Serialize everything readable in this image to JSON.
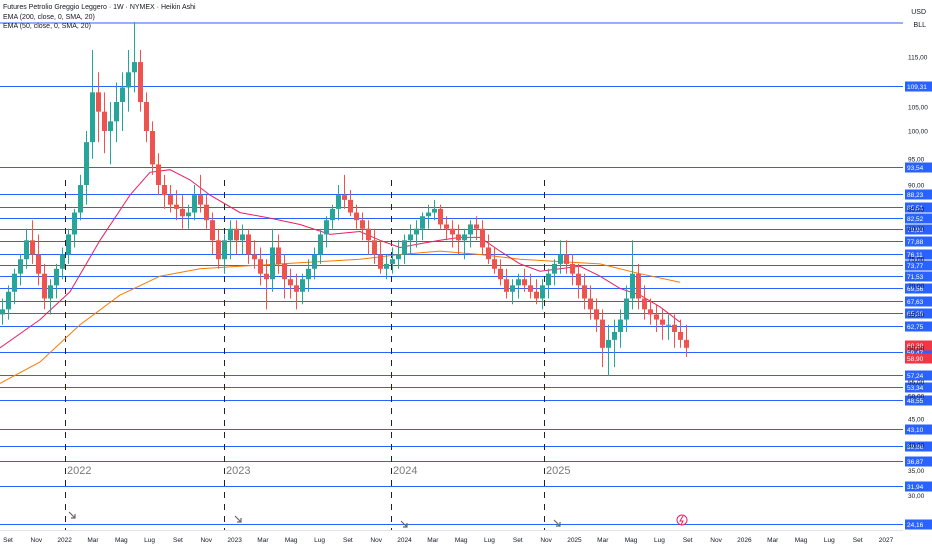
{
  "legend": {
    "title": "Futures Petrolio Greggio Leggero · 1W · NYMEX · Heikin Ashi",
    "ema200": "EMA (200, close, 0, SMA, 20)",
    "ema50": "EMA (50, close, 0, SMA, 20)"
  },
  "scale": {
    "currency": "USD",
    "unit": "BLL"
  },
  "colors": {
    "up": "#26a69a",
    "down": "#ef5350",
    "line": "#2962ff",
    "ema200": "#f57c00",
    "ema50": "#e91e63",
    "price_badge": "#f23645"
  },
  "chart_data": {
    "type": "candlestick",
    "y_axis_ticks": [
      "115,00",
      "105,00",
      "100,00",
      "95,00",
      "90,00",
      "85,00",
      "80,00",
      "75,00",
      "70,00",
      "65,00",
      "60,00",
      "55,00",
      "50,00",
      "45,00",
      "40,00",
      "35,00",
      "30,00"
    ],
    "horizontal_levels": [
      "109,31",
      "93,54",
      "88,23",
      "85,51",
      "82,52",
      "79,93",
      "77,88",
      "76,11",
      "73,77",
      "71,53",
      "69,56",
      "67,63",
      "65,28",
      "62,75",
      "59,47",
      "57,24",
      "53,34",
      "48,55",
      "43,10",
      "39,86",
      "36,87",
      "31,94",
      "24,16"
    ],
    "price_badges": [
      {
        "label": "60,30"
      },
      {
        "label": "58,90"
      }
    ],
    "x_axis_labels": [
      "Set",
      "Nov",
      "2022",
      "Mar",
      "Mag",
      "Lug",
      "Set",
      "Nov",
      "2023",
      "Mar",
      "Mag",
      "Lug",
      "Set",
      "Nov",
      "2024",
      "Mar",
      "Mag",
      "Lug",
      "Set",
      "Nov",
      "2025",
      "Mar",
      "Mag",
      "Lug",
      "Set",
      "Nov",
      "2026",
      "Mar",
      "Mag",
      "Lug",
      "Set",
      "2027"
    ],
    "year_markers": [
      "2022",
      "2023",
      "2024",
      "2025"
    ],
    "series": [
      {
        "name": "EMA (200, close, 0, SMA, 20)",
        "color": "#f57c00",
        "points": [
          [
            0,
            54.5
          ],
          [
            40,
            58.5
          ],
          [
            80,
            63
          ],
          [
            120,
            68.5
          ],
          [
            160,
            71.5
          ],
          [
            200,
            73
          ],
          [
            240,
            73.5
          ],
          [
            280,
            74
          ],
          [
            320,
            74.5
          ],
          [
            360,
            75
          ],
          [
            400,
            76
          ],
          [
            440,
            76.5
          ],
          [
            480,
            76
          ],
          [
            520,
            75
          ],
          [
            560,
            74.5
          ],
          [
            600,
            74
          ],
          [
            640,
            72
          ],
          [
            680,
            70.5
          ]
        ]
      },
      {
        "name": "EMA (50, close, 0, SMA, 20)",
        "color": "#e91e63",
        "points": [
          [
            0,
            60
          ],
          [
            40,
            64
          ],
          [
            70,
            69
          ],
          [
            100,
            78
          ],
          [
            130,
            88
          ],
          [
            150,
            92.5
          ],
          [
            170,
            93
          ],
          [
            190,
            91
          ],
          [
            210,
            88
          ],
          [
            240,
            84
          ],
          [
            270,
            82.5
          ],
          [
            300,
            81
          ],
          [
            330,
            79
          ],
          [
            360,
            79.5
          ],
          [
            380,
            78
          ],
          [
            400,
            77
          ],
          [
            420,
            77.5
          ],
          [
            440,
            78
          ],
          [
            460,
            78.5
          ],
          [
            480,
            78.5
          ],
          [
            500,
            76.5
          ],
          [
            520,
            74
          ],
          [
            540,
            72.5
          ],
          [
            560,
            73
          ],
          [
            580,
            73.5
          ],
          [
            600,
            71.5
          ],
          [
            620,
            69.5
          ],
          [
            640,
            68.5
          ],
          [
            660,
            66.5
          ],
          [
            680,
            63.5
          ]
        ]
      }
    ],
    "ohlc": [
      [
        0,
        65,
        68,
        63,
        66
      ],
      [
        6,
        66,
        70,
        64,
        69
      ],
      [
        12,
        69,
        73,
        67,
        72
      ],
      [
        18,
        72,
        76,
        70,
        75
      ],
      [
        24,
        75,
        80,
        73,
        78
      ],
      [
        30,
        78,
        82,
        74,
        76
      ],
      [
        36,
        76,
        79,
        70,
        72
      ],
      [
        42,
        72,
        74,
        66,
        68
      ],
      [
        48,
        68,
        71,
        65,
        70
      ],
      [
        54,
        70,
        74,
        68,
        73
      ],
      [
        60,
        73,
        77,
        71,
        76
      ],
      [
        66,
        76,
        80,
        74,
        79
      ],
      [
        72,
        79,
        85,
        77,
        84
      ],
      [
        78,
        84,
        92,
        82,
        90
      ],
      [
        84,
        90,
        100,
        86,
        98
      ],
      [
        90,
        98,
        116,
        95,
        108
      ],
      [
        96,
        108,
        112,
        98,
        104
      ],
      [
        102,
        104,
        108,
        96,
        100
      ],
      [
        108,
        100,
        106,
        94,
        102
      ],
      [
        114,
        102,
        110,
        98,
        106
      ],
      [
        120,
        106,
        112,
        100,
        109
      ],
      [
        126,
        109,
        116,
        104,
        112
      ],
      [
        132,
        112,
        120,
        108,
        114
      ],
      [
        138,
        114,
        116,
        104,
        106
      ],
      [
        144,
        106,
        108,
        98,
        100
      ],
      [
        150,
        100,
        102,
        92,
        94
      ],
      [
        156,
        94,
        96,
        88,
        90
      ],
      [
        162,
        90,
        92,
        85,
        88
      ],
      [
        168,
        88,
        90,
        84,
        86
      ],
      [
        174,
        86,
        89,
        82,
        85
      ],
      [
        180,
        85,
        88,
        80,
        83
      ],
      [
        186,
        83,
        86,
        80,
        84
      ],
      [
        192,
        84,
        90,
        82,
        88
      ],
      [
        198,
        88,
        92,
        84,
        86
      ],
      [
        204,
        86,
        88,
        80,
        82
      ],
      [
        210,
        82,
        84,
        76,
        78
      ],
      [
        216,
        78,
        80,
        73,
        75
      ],
      [
        222,
        75,
        79,
        72,
        78
      ],
      [
        228,
        78,
        82,
        75,
        80
      ],
      [
        234,
        80,
        82,
        76,
        78
      ],
      [
        240,
        78,
        81,
        76,
        79
      ],
      [
        246,
        79,
        80,
        74,
        76
      ],
      [
        252,
        76,
        78,
        73,
        75
      ],
      [
        258,
        75,
        77,
        70,
        72
      ],
      [
        264,
        72,
        75,
        66,
        71
      ],
      [
        270,
        71,
        80,
        69,
        77
      ],
      [
        276,
        77,
        79,
        72,
        74
      ],
      [
        282,
        74,
        76,
        68,
        71
      ],
      [
        288,
        71,
        73,
        68,
        70
      ],
      [
        294,
        70,
        72,
        66,
        69
      ],
      [
        300,
        69,
        72,
        67,
        71
      ],
      [
        306,
        71,
        75,
        69,
        73
      ],
      [
        312,
        73,
        77,
        71,
        76
      ],
      [
        318,
        76,
        80,
        74,
        79
      ],
      [
        324,
        79,
        83,
        77,
        82
      ],
      [
        330,
        82,
        86,
        80,
        85
      ],
      [
        336,
        85,
        90,
        82,
        88
      ],
      [
        342,
        88,
        92,
        85,
        87
      ],
      [
        348,
        87,
        89,
        83,
        84
      ],
      [
        354,
        84,
        86,
        80,
        82
      ],
      [
        360,
        82,
        84,
        78,
        80
      ],
      [
        366,
        80,
        82,
        76,
        78
      ],
      [
        372,
        78,
        80,
        74,
        76
      ],
      [
        378,
        76,
        78,
        72,
        73
      ],
      [
        384,
        73,
        76,
        71,
        74
      ],
      [
        390,
        74,
        77,
        72,
        75
      ],
      [
        396,
        75,
        78,
        73,
        76
      ],
      [
        402,
        76,
        79,
        74,
        78
      ],
      [
        408,
        78,
        81,
        76,
        79
      ],
      [
        414,
        79,
        82,
        77,
        80
      ],
      [
        420,
        80,
        84,
        78,
        83
      ],
      [
        426,
        83,
        86,
        80,
        84
      ],
      [
        432,
        84,
        87,
        82,
        85
      ],
      [
        438,
        85,
        86,
        80,
        81
      ],
      [
        444,
        81,
        83,
        78,
        80
      ],
      [
        450,
        80,
        82,
        77,
        79
      ],
      [
        456,
        79,
        81,
        76,
        78
      ],
      [
        462,
        78,
        80,
        75,
        79
      ],
      [
        468,
        79,
        82,
        77,
        81
      ],
      [
        474,
        81,
        83,
        78,
        80
      ],
      [
        480,
        80,
        82,
        76,
        77
      ],
      [
        486,
        77,
        79,
        74,
        75
      ],
      [
        492,
        75,
        77,
        72,
        73
      ],
      [
        498,
        73,
        75,
        70,
        71
      ],
      [
        504,
        71,
        73,
        68,
        69
      ],
      [
        510,
        69,
        71,
        67,
        70
      ],
      [
        516,
        70,
        72,
        68,
        71
      ],
      [
        522,
        71,
        73,
        69,
        70
      ],
      [
        528,
        70,
        72,
        68,
        69
      ],
      [
        534,
        69,
        71,
        67,
        68
      ],
      [
        540,
        68,
        71,
        66,
        70
      ],
      [
        546,
        70,
        73,
        68,
        72
      ],
      [
        552,
        72,
        75,
        70,
        74
      ],
      [
        558,
        74,
        78,
        72,
        76
      ],
      [
        564,
        76,
        78,
        72,
        74
      ],
      [
        570,
        74,
        76,
        70,
        72
      ],
      [
        576,
        72,
        74,
        68,
        70
      ],
      [
        582,
        70,
        72,
        66,
        68
      ],
      [
        588,
        68,
        70,
        64,
        66
      ],
      [
        594,
        66,
        68,
        62,
        64
      ],
      [
        600,
        64,
        66,
        58,
        60
      ],
      [
        606,
        60,
        63,
        57,
        61
      ],
      [
        612,
        61,
        64,
        58,
        62
      ],
      [
        618,
        62,
        66,
        60,
        64
      ],
      [
        624,
        64,
        70,
        62,
        68
      ],
      [
        630,
        68,
        78,
        66,
        72
      ],
      [
        636,
        72,
        74,
        66,
        68
      ],
      [
        642,
        68,
        70,
        64,
        66
      ],
      [
        648,
        66,
        68,
        63,
        65
      ],
      [
        654,
        65,
        67,
        62,
        64
      ],
      [
        660,
        64,
        66,
        61,
        63
      ],
      [
        666,
        63,
        65,
        61,
        63
      ],
      [
        672,
        63,
        65,
        60,
        62
      ],
      [
        678,
        62,
        64,
        60,
        61
      ],
      [
        684,
        61,
        63,
        59,
        60
      ]
    ]
  }
}
